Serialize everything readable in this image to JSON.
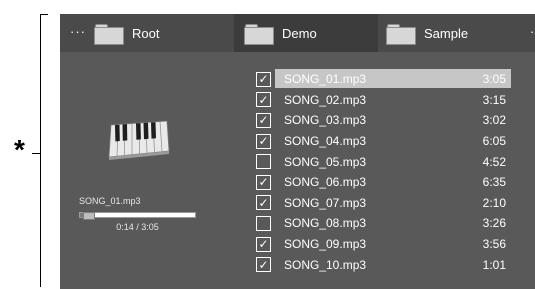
{
  "callout": {
    "marker": "*"
  },
  "topbar": {
    "left_more": "···",
    "right_more": "·",
    "tabs": [
      {
        "label": "Root",
        "icon": "folder-icon",
        "active": false
      },
      {
        "label": "Demo",
        "icon": "folder-icon",
        "active": true
      },
      {
        "label": "Sample",
        "icon": "folder-icon",
        "active": false
      }
    ]
  },
  "now_playing": {
    "art_icon": "piano-keyboard-icon",
    "title": "SONG_01.mp3",
    "progress_fraction": 0.076,
    "time": "0:14 / 3:05"
  },
  "songs": [
    {
      "name": "SONG_01.mp3",
      "duration": "3:05",
      "checked": true,
      "selected": true
    },
    {
      "name": "SONG_02.mp3",
      "duration": "3:15",
      "checked": true,
      "selected": false
    },
    {
      "name": "SONG_03.mp3",
      "duration": "3:02",
      "checked": true,
      "selected": false
    },
    {
      "name": "SONG_04.mp3",
      "duration": "6:05",
      "checked": true,
      "selected": false
    },
    {
      "name": "SONG_05.mp3",
      "duration": "4:52",
      "checked": false,
      "selected": false
    },
    {
      "name": "SONG_06.mp3",
      "duration": "6:35",
      "checked": true,
      "selected": false
    },
    {
      "name": "SONG_07.mp3",
      "duration": "2:10",
      "checked": true,
      "selected": false
    },
    {
      "name": "SONG_08.mp3",
      "duration": "3:26",
      "checked": false,
      "selected": false
    },
    {
      "name": "SONG_09.mp3",
      "duration": "3:56",
      "checked": true,
      "selected": false
    },
    {
      "name": "SONG_10.mp3",
      "duration": "1:01",
      "checked": true,
      "selected": false
    }
  ],
  "colors": {
    "screen_bg": "#595959",
    "topbar_bg": "#4a4a4a",
    "active_tab_bg": "#3c3c3c",
    "selected_row_bg": "#c6c6c6",
    "text": "#ffffff"
  }
}
